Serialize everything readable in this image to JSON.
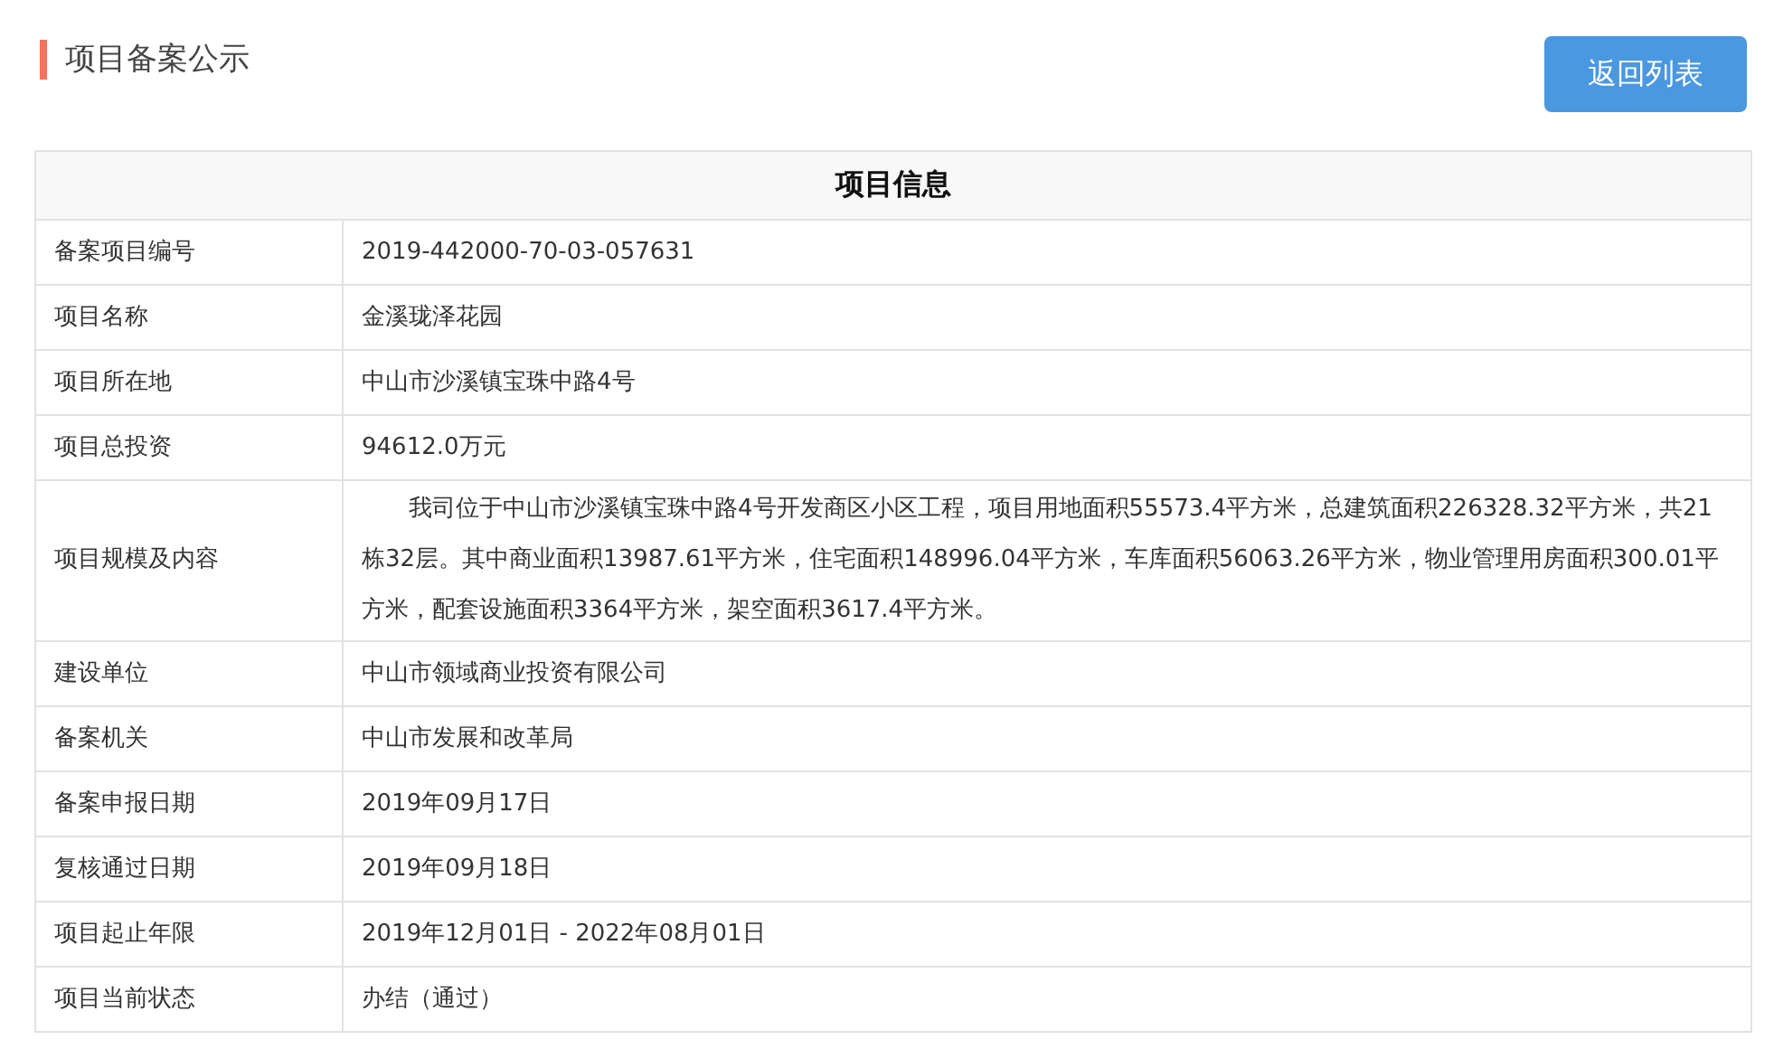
{
  "page_title": "项目备案公示",
  "back_button": "返回列表",
  "table": {
    "title": "项目信息",
    "rows": [
      {
        "label": "备案项目编号",
        "value": "2019-442000-70-03-057631"
      },
      {
        "label": "项目名称",
        "value": "金溪珑泽花园"
      },
      {
        "label": "项目所在地",
        "value": "中山市沙溪镇宝珠中路4号"
      },
      {
        "label": "项目总投资",
        "value": "94612.0万元"
      },
      {
        "label": "项目规模及内容",
        "value": "我司位于中山市沙溪镇宝珠中路4号开发商区小区工程，项目用地面积55573.4平方米，总建筑面积226328.32平方米，共21栋32层。其中商业面积13987.61平方米，住宅面积148996.04平方米，车库面积56063.26平方米，物业管理用房面积300.01平方米，配套设施面积3364平方米，架空面积3617.4平方米。"
      },
      {
        "label": "建设单位",
        "value": "中山市领域商业投资有限公司"
      },
      {
        "label": "备案机关",
        "value": "中山市发展和改革局"
      },
      {
        "label": "备案申报日期",
        "value": "2019年09月17日"
      },
      {
        "label": "复核通过日期",
        "value": "2019年09月18日"
      },
      {
        "label": "项目起止年限",
        "value": "2019年12月01日 - 2022年08月01日"
      },
      {
        "label": "项目当前状态",
        "value": "办结（通过）"
      }
    ]
  }
}
